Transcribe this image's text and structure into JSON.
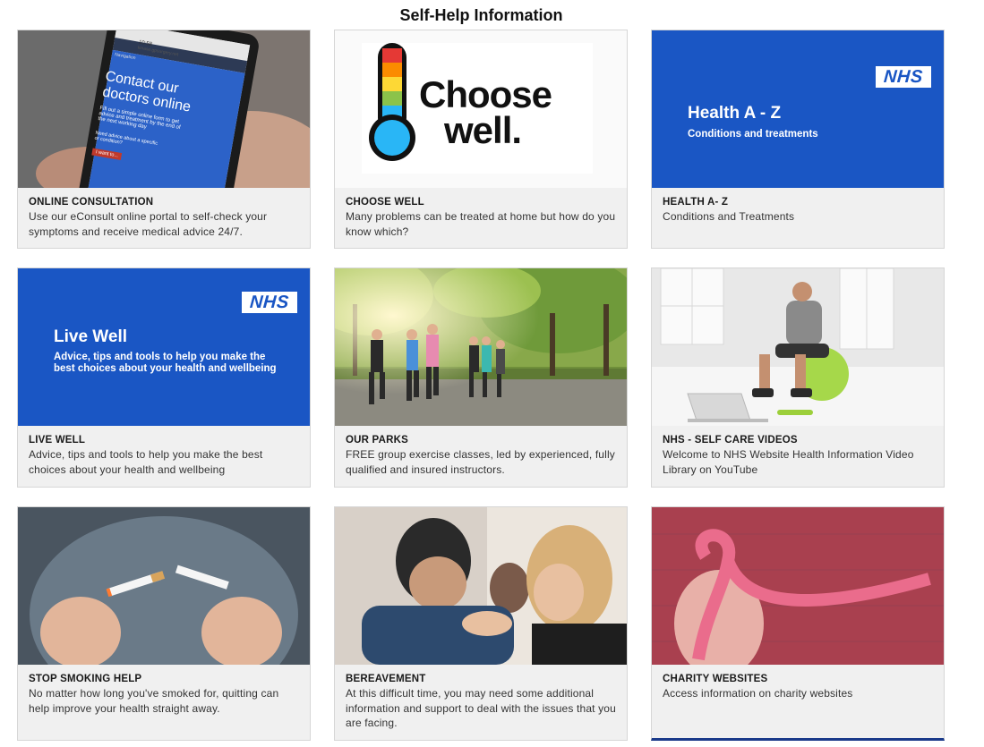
{
  "page": {
    "title": "Self-Help Information"
  },
  "cards": [
    {
      "title": "ONLINE CONSULTATION",
      "desc": "Use our eConsult online portal to self-check your symptoms and receive medical advice 24/7.",
      "phone": {
        "url": "kinase.gpsurgery.net",
        "time": "10:58",
        "nav": "Navigation",
        "heading1": "Contact our",
        "heading2": "doctors online",
        "body1": "Fill out a simple online form to get",
        "body2": "advice and treatment by the end of",
        "body3": "the next working day",
        "q1": "Need advice about a specific",
        "q2": "or condition?",
        "btn": "I want to..."
      }
    },
    {
      "title": "CHOOSE WELL",
      "desc": "Many problems can be treated at home but how do you know which?",
      "logo": {
        "line1": "Choose",
        "line2": "well."
      }
    },
    {
      "title": "HEALTH A- Z",
      "desc": "Conditions and Treatments",
      "banner": {
        "logo": "NHS",
        "title": "Health A - Z",
        "subtitle": "Conditions and treatments"
      }
    },
    {
      "title": "LIVE WELL",
      "desc": "Advice, tips and tools to help you make the best choices about your health and wellbeing",
      "banner": {
        "logo": "NHS",
        "title": "Live Well",
        "subtitle": "Advice, tips and tools to help you make the best choices about your health and wellbeing"
      }
    },
    {
      "title": "OUR PARKS",
      "desc": "FREE group exercise classes, led by experienced, fully qualified and insured instructors."
    },
    {
      "title": "NHS - SELF CARE VIDEOS",
      "desc": "Welcome to NHS Website Health Information Video Library on YouTube"
    },
    {
      "title": "STOP SMOKING HELP",
      "desc": "No matter how long you've smoked for, quitting can help improve your health straight away."
    },
    {
      "title": "BEREAVEMENT",
      "desc": "At this difficult time, you may need some additional information and support to deal with the issues that you are facing."
    },
    {
      "title": "CHARITY WEBSITES",
      "desc": "Access information on charity websites"
    }
  ],
  "colors": {
    "nhs_blue": "#1a56c4",
    "card_bg": "#f0f0f0",
    "ribbon_pink": "#e8507a"
  }
}
